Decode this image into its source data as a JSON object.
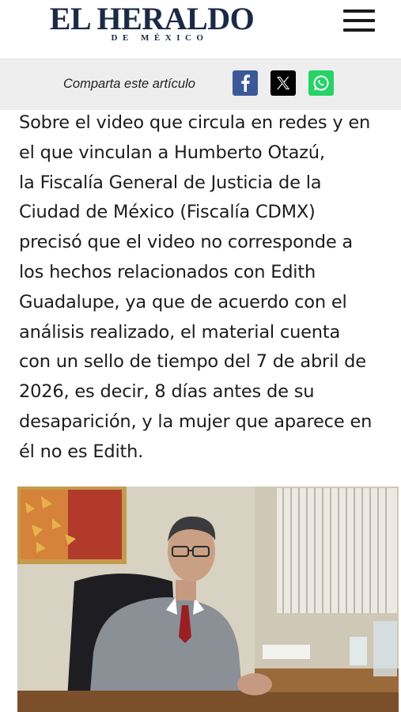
{
  "header": {
    "logo_main": "EL HERALDO",
    "logo_sub": "DE MÉXICO",
    "menu_icon": "hamburger-menu-icon"
  },
  "share": {
    "label": "Comparta este artículo",
    "buttons": [
      {
        "name": "facebook",
        "icon": "facebook-icon",
        "color": "#3b5998"
      },
      {
        "name": "x",
        "icon": "x-icon",
        "color": "#000000"
      },
      {
        "name": "whatsapp",
        "icon": "whatsapp-icon",
        "color": "#25d366"
      }
    ]
  },
  "article": {
    "lines": [
      "Sobre el video que circula en redes y en",
      "el que vinculan a Humberto Otazú,",
      "la Fiscalía General de Justicia de la",
      "Ciudad de México (Fiscalía CDMX)",
      "precisó que el video no corresponde a",
      "los hechos relacionados con Edith",
      "Guadalupe, ya que de acuerdo con el",
      "análisis realizado, el material cuenta",
      "con un sello de tiempo del 7 de abril de",
      "2026, es decir, 8 días antes de su",
      "desaparición, y la mujer que aparece en",
      "él no es Edith."
    ]
  },
  "colors": {
    "logo": "#1b2a44",
    "share_bar": "#eeeeee"
  }
}
